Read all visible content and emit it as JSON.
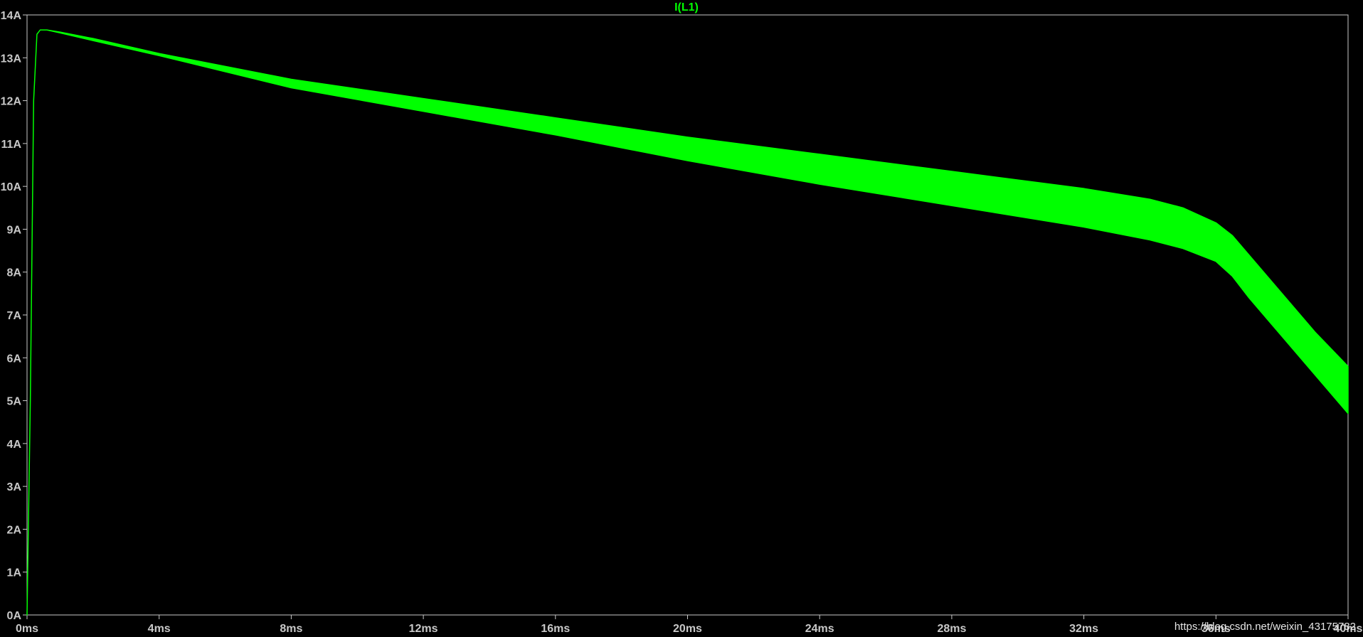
{
  "colors": {
    "background": "#000000",
    "axis": "#c8c8c8",
    "trace": "#00ff00"
  },
  "chart_data": {
    "type": "line",
    "title": "I(L1)",
    "x_ticks": [
      "0ms",
      "4ms",
      "8ms",
      "12ms",
      "16ms",
      "20ms",
      "24ms",
      "28ms",
      "32ms",
      "36ms",
      "40ms"
    ],
    "y_ticks": [
      "0A",
      "1A",
      "2A",
      "3A",
      "4A",
      "5A",
      "6A",
      "7A",
      "8A",
      "9A",
      "10A",
      "11A",
      "12A",
      "13A",
      "14A"
    ],
    "xlim": [
      0,
      40
    ],
    "ylim": [
      0,
      14
    ],
    "x_unit": "ms",
    "y_unit": "A",
    "grid": false,
    "series": [
      {
        "name": "I(L1)",
        "style": "envelope",
        "x": [
          0,
          0.1,
          0.2,
          0.3,
          0.4,
          0.6,
          1.0,
          2,
          4,
          8,
          12,
          16,
          20,
          24,
          28,
          32,
          34,
          35,
          36,
          36.5,
          37,
          38,
          39,
          40
        ],
        "upper": [
          0,
          5.0,
          12.0,
          13.55,
          13.65,
          13.65,
          13.6,
          13.45,
          13.1,
          12.5,
          12.05,
          11.6,
          11.15,
          10.75,
          10.35,
          9.95,
          9.7,
          9.5,
          9.15,
          8.85,
          8.4,
          7.5,
          6.6,
          5.8
        ],
        "lower": [
          0,
          5.0,
          12.0,
          13.55,
          13.65,
          13.65,
          13.58,
          13.4,
          13.05,
          12.3,
          11.75,
          11.2,
          10.6,
          10.05,
          9.55,
          9.05,
          8.75,
          8.55,
          8.25,
          7.9,
          7.4,
          6.5,
          5.6,
          4.7
        ]
      }
    ]
  },
  "watermark": "https://blog.csdn.net/weixin_43175782"
}
